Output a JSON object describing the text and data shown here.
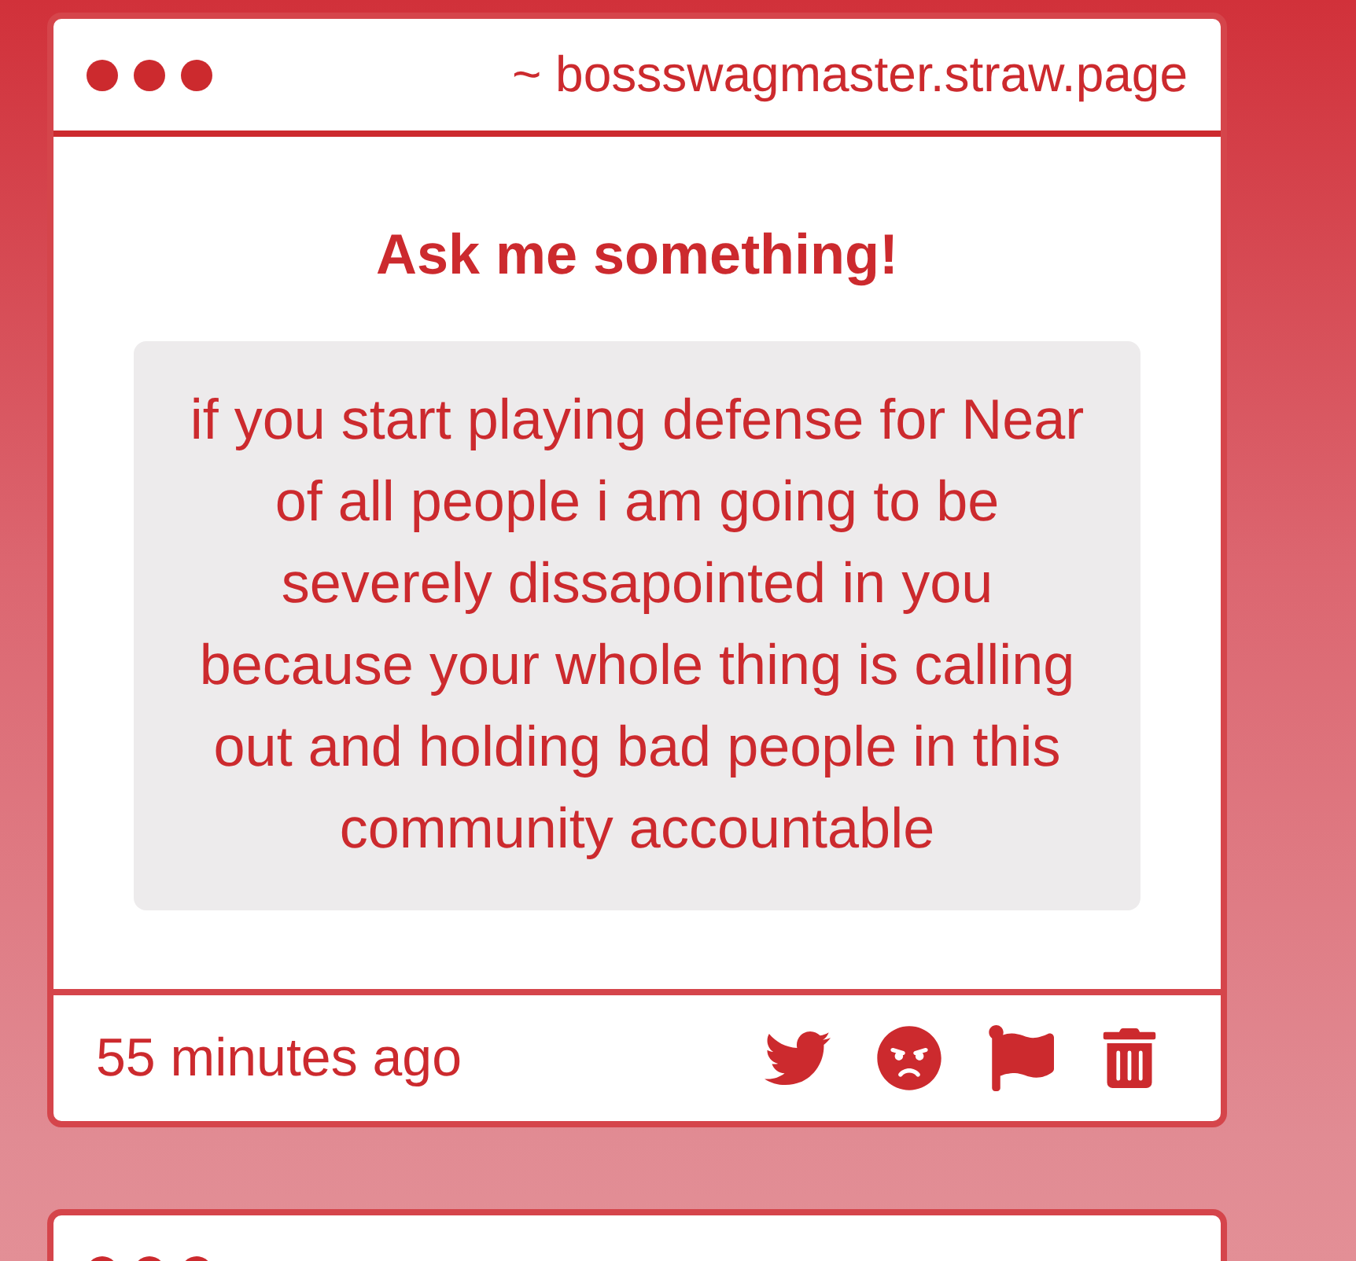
{
  "cards": [
    {
      "kind": "full",
      "window": {
        "title": "~ bossswagmaster.straw.page"
      },
      "heading": "Ask me something!",
      "question": "if you start playing defense for Near of all people i am going to be severely dissapointed in you because your whole thing is calling out and holding bad people in this community accountable",
      "timestamp": "55 minutes ago",
      "actions": [
        {
          "kind": "twitter"
        },
        {
          "kind": "angry"
        },
        {
          "kind": "flag"
        },
        {
          "kind": "delete"
        }
      ]
    },
    {
      "kind": "clipped"
    }
  ]
}
